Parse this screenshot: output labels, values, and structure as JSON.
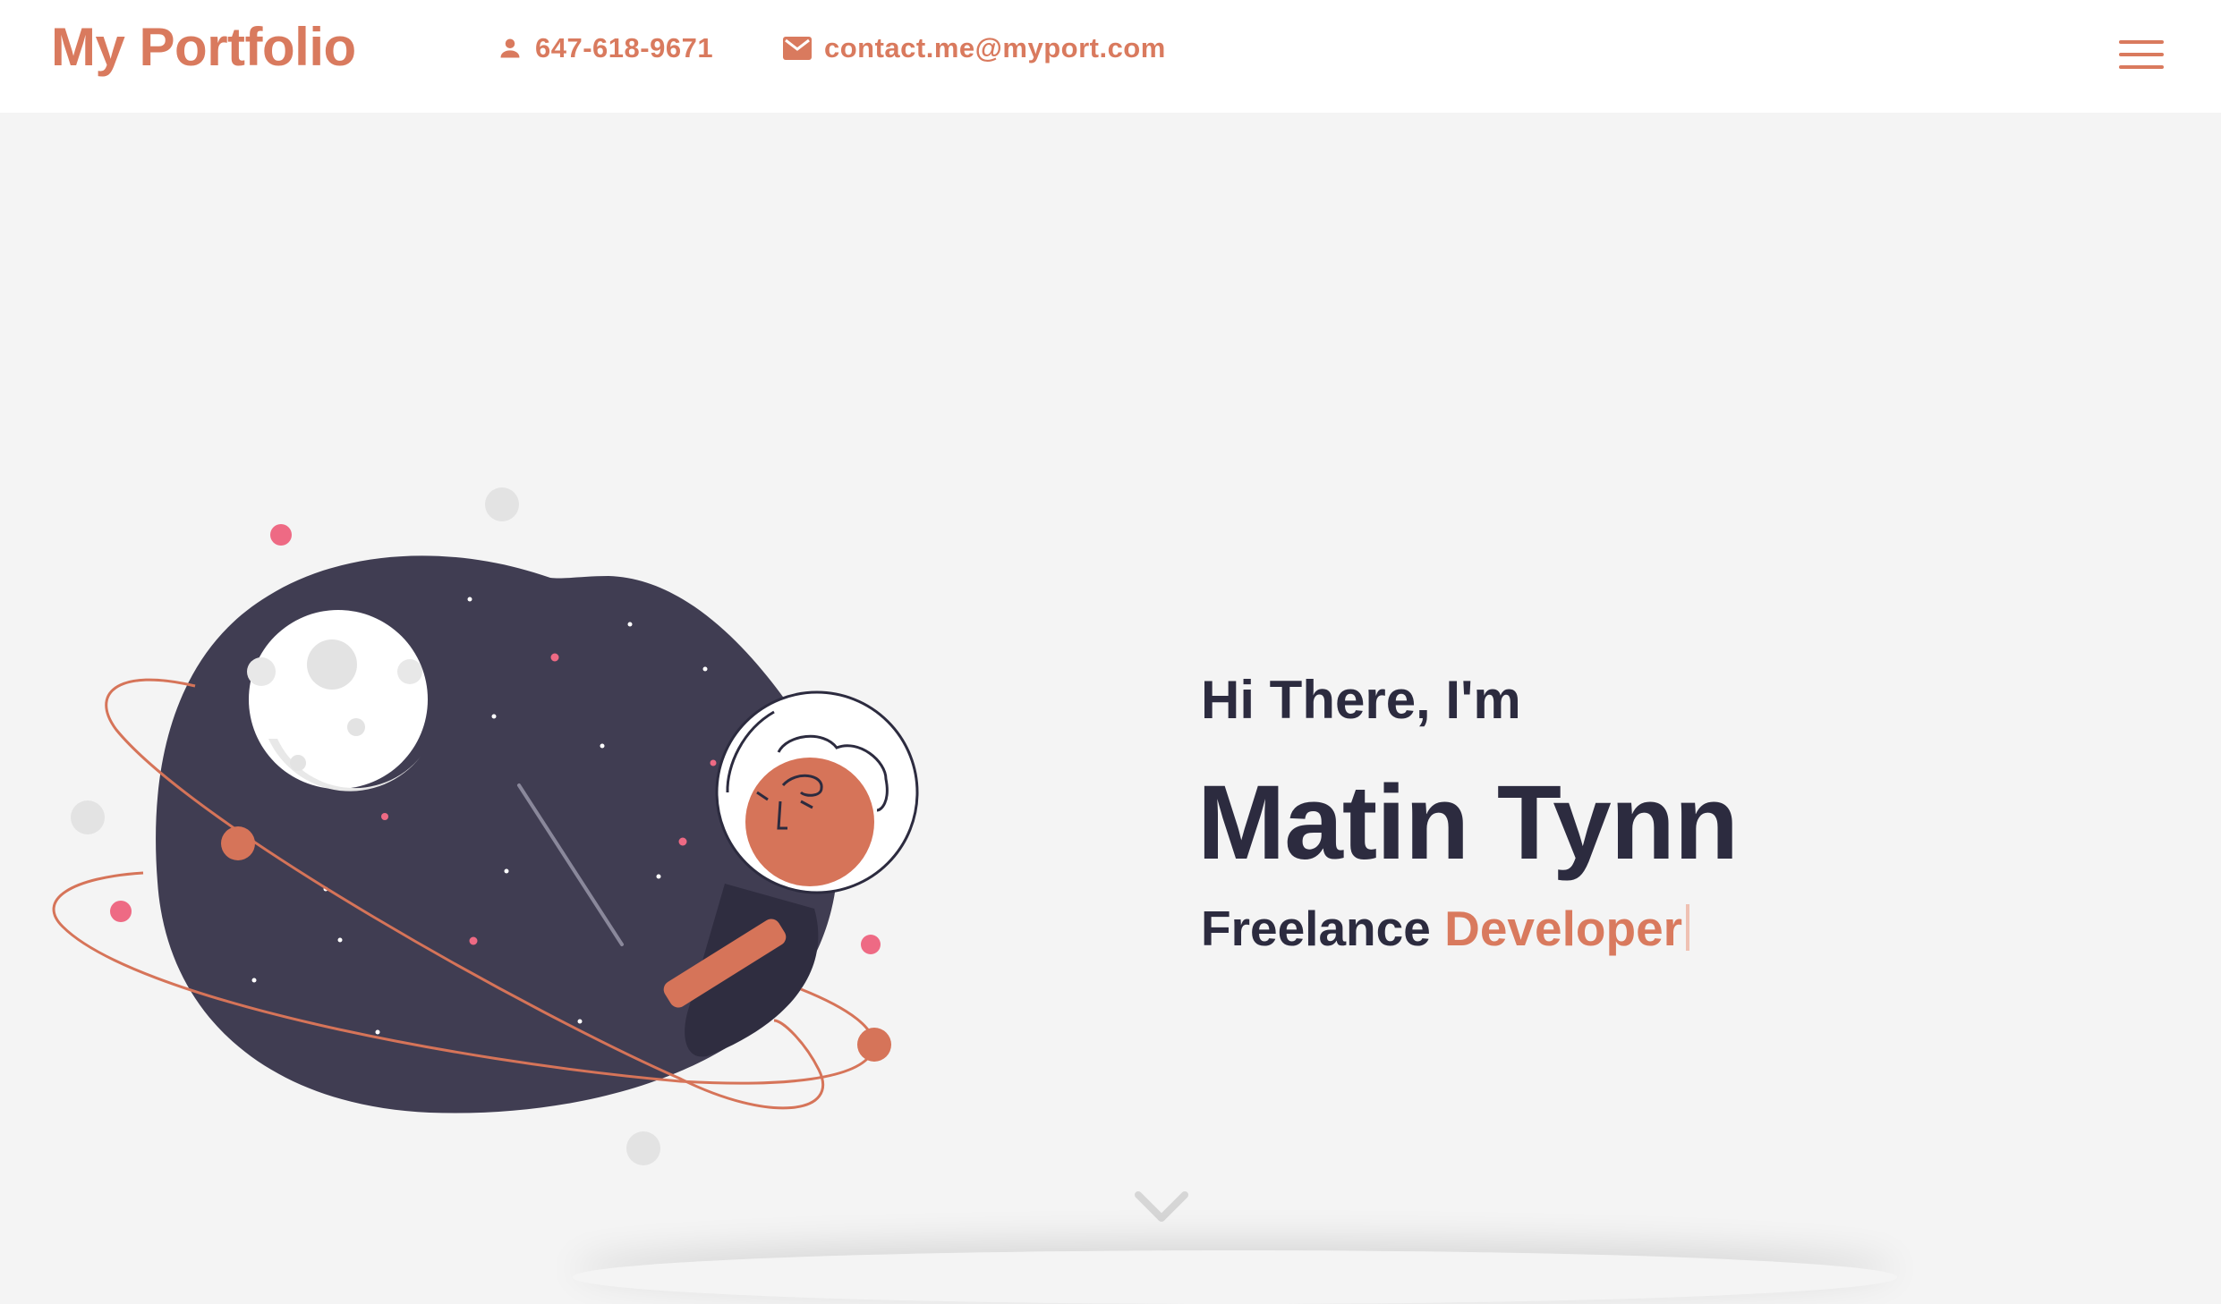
{
  "header": {
    "brand": "My Portfolio",
    "phone": "647-618-9671",
    "email": "contact.me@myport.com",
    "phone_icon": "person-icon",
    "email_icon": "mail-icon",
    "menu_icon": "hamburger-icon"
  },
  "hero": {
    "greeting": "Hi There, I'm",
    "name": "Matin Tynn",
    "tagline_prefix": "Freelance",
    "tagline_role": "Developer",
    "scroll_icon": "chevron-down-icon"
  },
  "colors": {
    "accent": "#d97a5e",
    "dark": "#2c2b3f",
    "background": "#f4f4f4",
    "planet": "#403d52"
  }
}
